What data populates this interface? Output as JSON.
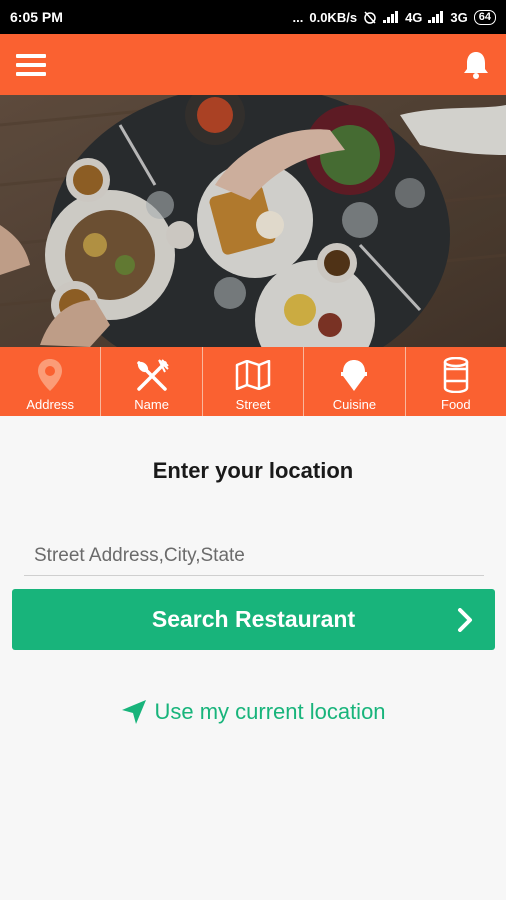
{
  "status_bar": {
    "time": "6:05 PM",
    "dots": "...",
    "speed": "0.0KB/s",
    "net1": "4G",
    "net2": "3G",
    "battery": "64"
  },
  "app_bar": {
    "menu_icon": "hamburger-menu-icon",
    "bell_icon": "notification-bell-icon"
  },
  "hero": {
    "image": "restaurant-table-food-photo"
  },
  "categories": [
    {
      "label": "Address",
      "icon": "location-pin-icon"
    },
    {
      "label": "Name",
      "icon": "fork-spoon-icon"
    },
    {
      "label": "Street",
      "icon": "map-icon"
    },
    {
      "label": "Cuisine",
      "icon": "ice-cream-icon"
    },
    {
      "label": "Food",
      "icon": "can-icon"
    }
  ],
  "main": {
    "title": "Enter your location",
    "address_placeholder": "Street Address,City,State",
    "address_value": "",
    "search_label": "Search Restaurant",
    "current_location_label": "Use my current location"
  },
  "colors": {
    "primary": "#fa6131",
    "accent": "#18b47b",
    "background": "#f7f7f7"
  }
}
